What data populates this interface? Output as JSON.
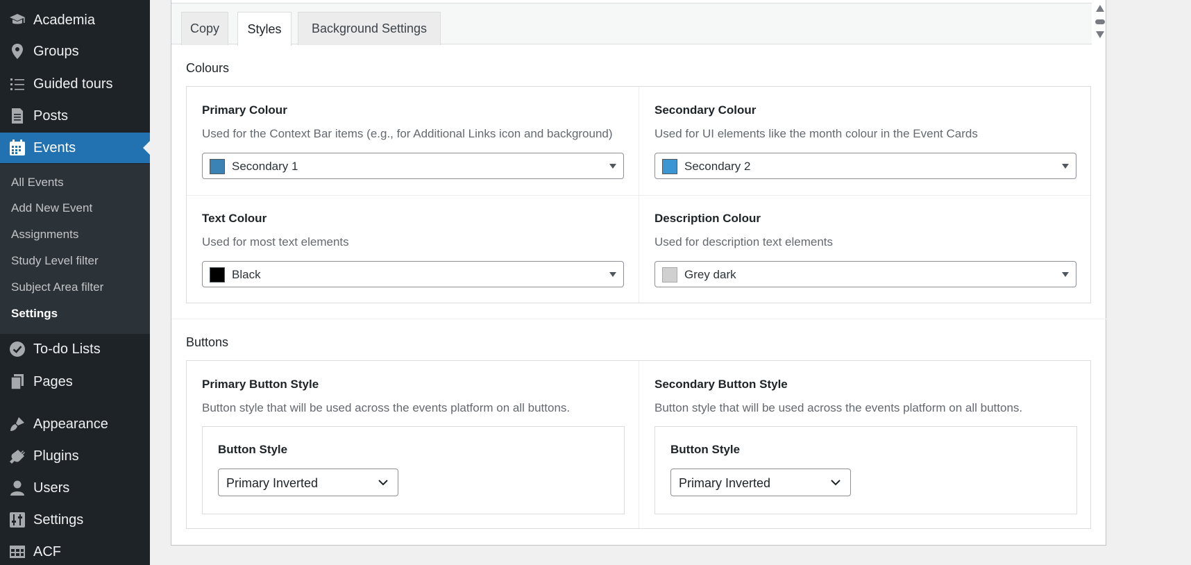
{
  "sidebar": {
    "menu": [
      {
        "label": "Academia",
        "icon": "graduation-cap-icon"
      },
      {
        "label": "Groups",
        "icon": "location-pin-icon"
      },
      {
        "label": "Guided tours",
        "icon": "list-icon"
      },
      {
        "label": "Posts",
        "icon": "pushpin-document-icon"
      },
      {
        "label": "Events",
        "icon": "calendar-icon"
      }
    ],
    "submenu": [
      "All Events",
      "Add New Event",
      "Assignments",
      "Study Level filter",
      "Subject Area filter",
      "Settings"
    ],
    "menu_lower": [
      {
        "label": "To-do Lists",
        "icon": "check-circle-icon"
      },
      {
        "label": "Pages",
        "icon": "pages-icon"
      },
      {
        "label": "Appearance",
        "icon": "paintbrush-icon"
      },
      {
        "label": "Plugins",
        "icon": "plug-icon"
      },
      {
        "label": "Users",
        "icon": "user-icon"
      },
      {
        "label": "Settings",
        "icon": "sliders-icon"
      },
      {
        "label": "ACF",
        "icon": "table-icon"
      }
    ]
  },
  "tabs": [
    "Copy",
    "Styles",
    "Background Settings"
  ],
  "colours": {
    "title": "Colours",
    "primary": {
      "label": "Primary Colour",
      "desc": "Used for the Context Bar items (e.g., for Additional Links icon and background)",
      "value": "Secondary 1",
      "swatch": "#3a83b4"
    },
    "secondary": {
      "label": "Secondary Colour",
      "desc": "Used for UI elements like the month colour in the Event Cards",
      "value": "Secondary 2",
      "swatch": "#3d96d4"
    },
    "text": {
      "label": "Text Colour",
      "desc": "Used for most text elements",
      "value": "Black",
      "swatch": "#000000"
    },
    "description": {
      "label": "Description Colour",
      "desc": "Used for description text elements",
      "value": "Grey dark",
      "swatch": "#d0d0d0"
    }
  },
  "buttons": {
    "title": "Buttons",
    "primary": {
      "label": "Primary Button Style",
      "desc": "Button style that will be used across the events platform on all buttons.",
      "inner_label": "Button Style",
      "value": "Primary Inverted"
    },
    "secondary": {
      "label": "Secondary Button Style",
      "desc": "Button style that will be used across the events platform on all buttons.",
      "inner_label": "Button Style",
      "value": "Primary Inverted"
    }
  }
}
